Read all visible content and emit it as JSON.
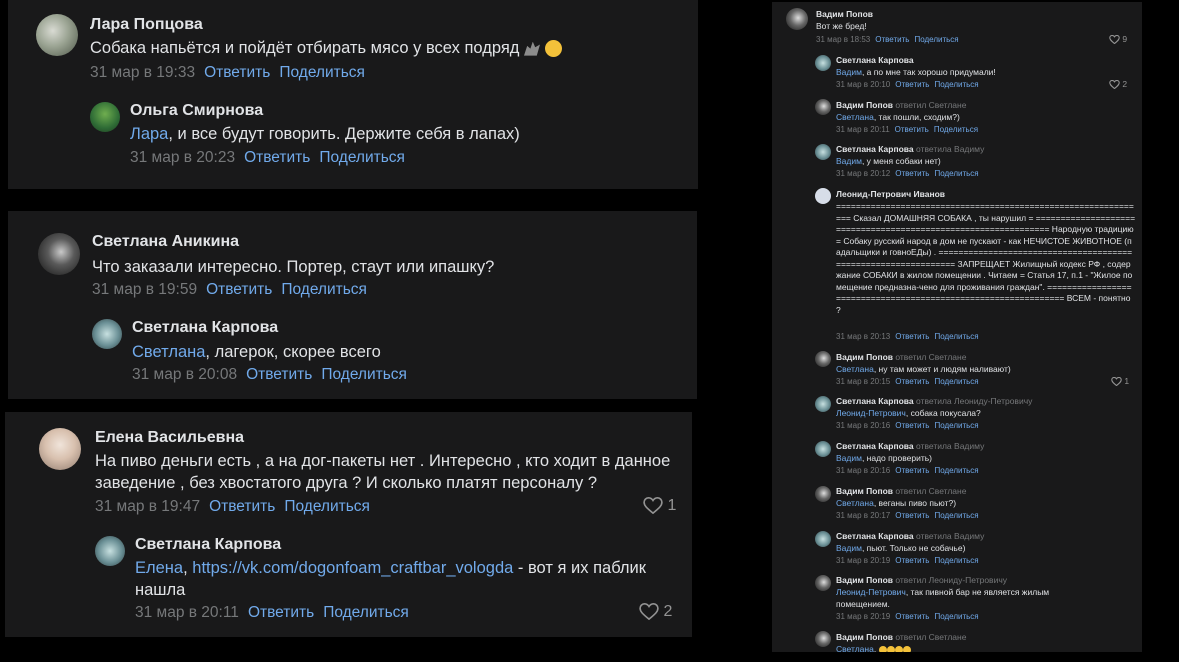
{
  "panel1": {
    "c1": {
      "author": "Лара Попцова",
      "text": "Собака напьётся и пойдёт отбирать мясо у всех подряд",
      "date": "31 мар в 19:33"
    },
    "c2": {
      "author": "Ольга Смирнова",
      "mention": "Лара",
      "text": ", и все будут говорить. Держите себя в лапах)",
      "date": "31 мар в 20:23"
    }
  },
  "panel2": {
    "c1": {
      "author": "Светлана Аникина",
      "text": "Что заказали интересно. Портер, стаут или ипашку?",
      "date": "31 мар в 19:59"
    },
    "c2": {
      "author": "Светлана Карпова",
      "mention": "Светлана",
      "text": ", лагерок, скорее всего",
      "date": "31 мар в 20:08"
    }
  },
  "panel3": {
    "c1": {
      "author": "Елена Васильевна",
      "text": "На пиво деньги есть , а на дог-пакеты нет . Интересно , кто ходит в данное заведение , без хвостатого друга ? И сколько платят персоналу ?",
      "date": "31 мар в 19:47",
      "likes": "1"
    },
    "c2": {
      "author": "Светлана Карпова",
      "mention": "Елена",
      "link": "https://vk.com/dogonfoam_craftbar_vologda",
      "text": " - вот я их паблик нашла",
      "date": "31 мар в 20:11",
      "likes": "2"
    }
  },
  "actions": {
    "reply": "Ответить",
    "share": "Поделиться"
  },
  "panel4": {
    "comments": [
      {
        "author": "Вадим Попов",
        "reply_to": "",
        "mention": "",
        "text": "Вот же бред!",
        "date": "31 мар в 18:53",
        "likes": "9"
      },
      {
        "author": "Светлана Карпова",
        "reply_to": "",
        "mention": "Вадим",
        "text": ", а по мне так хорошо придумали!",
        "date": "31 мар в 20:10",
        "likes": "2"
      },
      {
        "author": "Вадим Попов",
        "reply_to": "ответил Светлане",
        "mention": "Светлана",
        "text": ", так пошли, сходим?)",
        "date": "31 мар в 20:11",
        "likes": ""
      },
      {
        "author": "Светлана Карпова",
        "reply_to": "ответила Вадиму",
        "mention": "Вадим",
        "text": ", у меня собаки нет)",
        "date": "31 мар в 20:12",
        "likes": ""
      },
      {
        "author": "Леонид-Петрович Иванов",
        "reply_to": "",
        "mention": "",
        "text": "=============================================================== Сказал ДОМАШНЯЯ СОБАКА , ты нарушил = =============================================================== Народную традицию = Собаку русский народ в дом не пускают - как НЕЧИСТОЕ ЖИВОТНОЕ (падальщики и говноЕДы) . =============================================================== ЗАПРЕЩАЕТ Жилищный кодекс РФ , содержание СОБАКИ в жилом помещении . Читаем = Статья 17, п.1 - \"Жилое помещение предназна-чено для проживания граждан\". =============================================================== ВСЕМ - понятно ?",
        "date": "31 мар в 20:13",
        "likes": ""
      },
      {
        "author": "Вадим Попов",
        "reply_to": "ответил Светлане",
        "mention": "Светлана",
        "text": ", ну там может и людям наливают)",
        "date": "31 мар в 20:15",
        "likes": "1"
      },
      {
        "author": "Светлана Карпова",
        "reply_to": "ответила Леониду-Петровичу",
        "mention": "Леонид-Петрович",
        "text": ", собака покусала?",
        "date": "31 мар в 20:16",
        "likes": ""
      },
      {
        "author": "Светлана Карпова",
        "reply_to": "ответила Вадиму",
        "mention": "Вадим",
        "text": ", надо проверить)",
        "date": "31 мар в 20:16",
        "likes": ""
      },
      {
        "author": "Вадим Попов",
        "reply_to": "ответил Светлане",
        "mention": "Светлана",
        "text": ", веганы пиво пьют?)",
        "date": "31 мар в 20:17",
        "likes": ""
      },
      {
        "author": "Светлана Карпова",
        "reply_to": "ответила Вадиму",
        "mention": "Вадим",
        "text": ", пьют. Только не собачье)",
        "date": "31 мар в 20:19",
        "likes": ""
      },
      {
        "author": "Вадим Попов",
        "reply_to": "ответил Леониду-Петровичу",
        "mention": "Леонид-Петрович",
        "text": ", так пивной бар не является жилым помещением.",
        "date": "31 мар в 20:19",
        "likes": ""
      },
      {
        "author": "Вадим Попов",
        "reply_to": "ответил Светлане",
        "mention": "Светлана",
        "text": ",",
        "date": "",
        "likes": ""
      }
    ]
  },
  "colors": {
    "bg": "#19191a",
    "text": "#e1e3e6",
    "muted": "#76787a",
    "link": "#71aaeb",
    "page": "#000000"
  }
}
